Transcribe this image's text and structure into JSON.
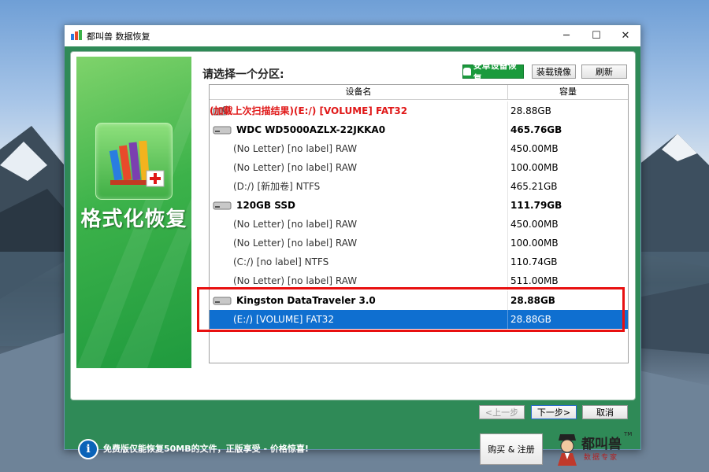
{
  "window": {
    "title": "都叫兽 数据恢复",
    "controls": {
      "minimize": "─",
      "maximize": "☐",
      "close": "✕"
    }
  },
  "banner": {
    "title": "格式化恢复"
  },
  "toolbar": {
    "prompt": "请选择一个分区:",
    "android_button": "安卓设备恢复",
    "load_image_button": "装载镜像",
    "refresh_button": "刷新"
  },
  "list": {
    "columns": [
      "设备名",
      "容量"
    ],
    "rows": [
      {
        "name": "(加载上次扫描结果)(E:/) [VOLUME] FAT32",
        "size": "28.88GB",
        "kind": "scan-result"
      },
      {
        "name": "WDC WD5000AZLX-22JKKA0",
        "size": "465.76GB",
        "kind": "disk"
      },
      {
        "name": "(No Letter) [no label] RAW",
        "size": "450.00MB",
        "kind": "partition"
      },
      {
        "name": "(No Letter) [no label] RAW",
        "size": "100.00MB",
        "kind": "partition"
      },
      {
        "name": "(D:/) [新加卷] NTFS",
        "size": "465.21GB",
        "kind": "partition"
      },
      {
        "name": "120GB SSD",
        "size": "111.79GB",
        "kind": "disk"
      },
      {
        "name": "(No Letter) [no label] RAW",
        "size": "450.00MB",
        "kind": "partition"
      },
      {
        "name": "(No Letter) [no label] RAW",
        "size": "100.00MB",
        "kind": "partition"
      },
      {
        "name": "(C:/) [no label] NTFS",
        "size": "110.74GB",
        "kind": "partition"
      },
      {
        "name": "(No Letter) [no label] RAW",
        "size": "511.00MB",
        "kind": "partition"
      },
      {
        "name": "Kingston DataTraveler 3.0",
        "size": "28.88GB",
        "kind": "disk"
      },
      {
        "name": "(E:/) [VOLUME] FAT32",
        "size": "28.88GB",
        "kind": "partition",
        "selected": true
      }
    ]
  },
  "nav": {
    "prev": "<上一步",
    "next": "下一步>",
    "cancel": "取消"
  },
  "footer": {
    "notice": "免费版仅能恢复50MB的文件，正版享受 - 价格惊喜!",
    "buy_button": "购买 & 注册",
    "logo_text": "都叫兽",
    "logo_subtitle": "数据专家",
    "logo_tm": "TM"
  },
  "colors": {
    "accent_green": "#2f8a57",
    "selection_blue": "#0f6fd0",
    "highlight_red": "#e81010",
    "scan_red": "#e01818"
  },
  "icons": {
    "app": "app-logo-icon",
    "disk": "hard-drive-icon",
    "info": "info-icon",
    "scan": "magnifier-drive-icon"
  }
}
